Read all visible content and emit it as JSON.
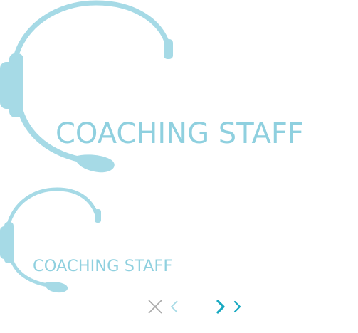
{
  "brand": {
    "primary_color": "#a6dae6",
    "text_color": "#8fd0df",
    "accent_color": "#18a9c1",
    "muted_color": "#a9a9a9",
    "icon": "headset-icon"
  },
  "logos": [
    {
      "name": "logo-large",
      "text": "COACHING STAFF"
    },
    {
      "name": "logo-small",
      "text": "COACHING STAFF"
    }
  ],
  "controls": {
    "close_icon": "close-icon",
    "prev_icon": "chevron-left-icon",
    "next_icon": "double-chevron-right-icon"
  }
}
